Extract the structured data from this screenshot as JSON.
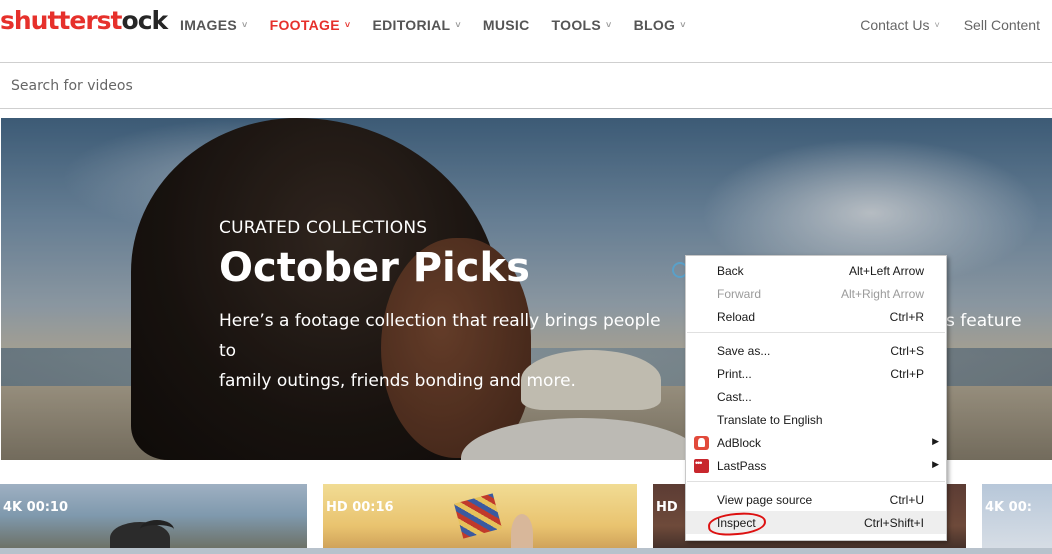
{
  "brand": {
    "logo_prefix": "shutterst",
    "logo_o": "o",
    "logo_suffix": "ck"
  },
  "nav": {
    "items": [
      {
        "label": "IMAGES",
        "caret": "˅"
      },
      {
        "label": "FOOTAGE",
        "caret": "˅"
      },
      {
        "label": "EDITORIAL",
        "caret": "˅"
      },
      {
        "label": "MUSIC"
      },
      {
        "label": "TOOLS",
        "caret": "˅"
      },
      {
        "label": "BLOG",
        "caret": "˅"
      }
    ],
    "right": [
      {
        "label": "Contact Us",
        "caret": "˅"
      },
      {
        "label": "Sell Content"
      }
    ]
  },
  "search": {
    "placeholder": "Search for videos"
  },
  "hero": {
    "eyebrow": "CURATED COLLECTIONS",
    "title": "October Picks",
    "description": "Here’s a footage collection that really brings people to",
    "description_line2": "family outings, friends bonding and more.",
    "description_tail": "s feature"
  },
  "thumbnails": [
    {
      "badge": "4K  00:10"
    },
    {
      "badge": "HD  00:16"
    },
    {
      "badge": "HD"
    },
    {
      "badge": "4K  00:"
    }
  ],
  "context_menu": {
    "items": [
      {
        "label": "Back",
        "shortcut": "Alt+Left Arrow"
      },
      {
        "label": "Forward",
        "shortcut": "Alt+Right Arrow",
        "disabled": true
      },
      {
        "label": "Reload",
        "shortcut": "Ctrl+R"
      },
      {
        "label": "Save as...",
        "shortcut": "Ctrl+S"
      },
      {
        "label": "Print...",
        "shortcut": "Ctrl+P"
      },
      {
        "label": "Cast..."
      },
      {
        "label": "Translate to English"
      },
      {
        "label": "AdBlock",
        "icon": "adblock-icon",
        "submenu": "▶"
      },
      {
        "label": "LastPass",
        "icon": "lastpass-icon",
        "submenu": "▶"
      },
      {
        "label": "View page source",
        "shortcut": "Ctrl+U"
      },
      {
        "label": "Inspect",
        "shortcut": "Ctrl+Shift+I"
      }
    ]
  },
  "colors": {
    "brand_red": "#e6302b",
    "circle_annotation": "#dd1111"
  }
}
